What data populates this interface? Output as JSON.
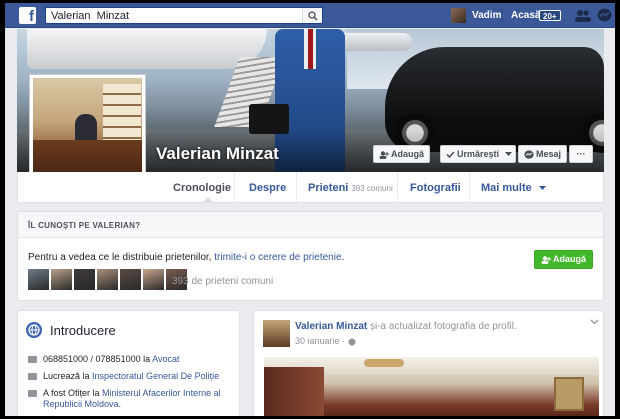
{
  "topbar": {
    "logo": "f",
    "search_value": "Valerian  Minzat",
    "user_name": "Vadim",
    "home_label": "Acasă",
    "home_badge": "20+"
  },
  "profile": {
    "name": "Valerian Minzat",
    "buttons": {
      "add": "Adaugă",
      "follow": "Urmărești",
      "message": "Mesaj",
      "more": "···"
    }
  },
  "tabs": [
    {
      "label": "Cronologie",
      "count": ""
    },
    {
      "label": "Despre",
      "count": ""
    },
    {
      "label": "Prieteni",
      "count": "393 comuni"
    },
    {
      "label": "Fotografii",
      "count": ""
    },
    {
      "label": "Mai multe",
      "count": ""
    }
  ],
  "know_panel": {
    "title": "ÎL CUNOȘTI PE VALERIAN?",
    "text_before": "Pentru a vedea ce le distribuie prietenilor, ",
    "link": "trimite-i o cerere de prietenie",
    "text_after": ".",
    "add_button": "Adaugă",
    "mutual_friends": "393 de prieteni comuni",
    "friend_colors": [
      "#6d7a88",
      "#b9a08a",
      "#3e3a39",
      "#a98f7a",
      "#5a4a44",
      "#c7a58c",
      "#7b5c4f"
    ]
  },
  "intro": {
    "title": "Introducere",
    "items": [
      {
        "text": "068851000 / 078851000 la ",
        "link": "Avocat",
        "extra": ""
      },
      {
        "text": "Lucrează la ",
        "link": "Inspectoratul General De Poliție",
        "extra": ""
      },
      {
        "text": "A fost Ofițer la ",
        "link": "Ministerul Afacerilor Interne al",
        "extra": ""
      },
      {
        "text": "",
        "link": "Republicii Moldova",
        "extra": "."
      }
    ]
  },
  "post": {
    "author": "Valerian Minzat",
    "action": "și-a actualizat fotografia de profil.",
    "date": "30 ianuarie · "
  },
  "colors": {
    "brand": "#3b5998",
    "link": "#365899",
    "green": "#42b72a"
  }
}
